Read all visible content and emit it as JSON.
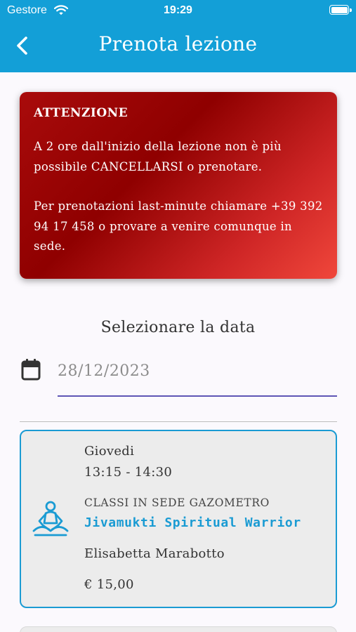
{
  "status_bar": {
    "carrier": "Gestore",
    "time": "19:29"
  },
  "header": {
    "title": "Prenota lezione"
  },
  "notice": {
    "heading": "ATTENZIONE",
    "paragraph1": "A 2 ore dall'inizio della lezione non è più possibile CANCELLARSI o prenotare.",
    "paragraph2": "Per prenotazioni last-minute chiamare +39 392 94 17 458 o provare a venire comunque in sede."
  },
  "date_picker": {
    "label": "Selezionare la data",
    "value": "28/12/2023"
  },
  "lessons": [
    {
      "day": "Giovedi",
      "time": "13:15 - 14:30",
      "location": "CLASSI IN SEDE GAZOMETRO",
      "name": "Jivamukti Spiritual Warrior",
      "teacher": "Elisabetta Marabotto",
      "price": "€ 15,00"
    }
  ],
  "icons": {
    "back": "chevron-left-icon",
    "calendar": "calendar-icon",
    "lesson": "yoga-meditation-icon",
    "wifi": "wifi-icon",
    "battery": "battery-icon"
  },
  "colors": {
    "header": "#139fd7",
    "accent": "#1a9bd3",
    "alert_dark": "#8f0000",
    "alert_light": "#f0473b",
    "input_underline": "#5e55b5"
  }
}
